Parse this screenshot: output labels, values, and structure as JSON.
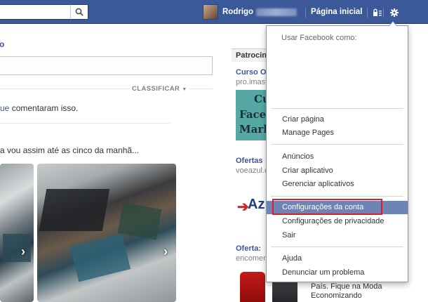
{
  "topbar": {
    "user_name": "Rodrigo",
    "home_label": "Página inicial"
  },
  "feed": {
    "heading_fragment": "o",
    "sort_label": "CLASSIFICAR",
    "comment_link_fragment": "ue",
    "comment_text": " comentaram isso.",
    "post_text": "a vou assim até as cinco da manhã..."
  },
  "sidebar": {
    "sponsored_header": "Patrocin",
    "ads": [
      {
        "title": "Curso O",
        "subtitle": "pro.imast",
        "image_lines": [
          "Cu",
          "Face",
          "Mark"
        ]
      },
      {
        "title": "Ofertas",
        "subtitle": "voeazul.c",
        "image_text": "Az"
      },
      {
        "title": "Oferta: ",
        "subtitle": "encomen",
        "description_lines": [
          "País. Fique na Moda",
          "Economizando"
        ]
      }
    ]
  },
  "account_menu": {
    "use_as_label": "Usar Facebook como:",
    "groups": [
      [
        "Criar página",
        "Manage Pages"
      ],
      [
        "Anúncios",
        "Criar aplicativo",
        "Gerenciar aplicativos"
      ],
      [
        "Configurações da conta",
        "Configurações de privacidade",
        "Sair"
      ],
      [
        "Ajuda",
        "Denunciar um problema"
      ]
    ],
    "active_item": "Configurações da conta"
  },
  "colors": {
    "topbar": "#3b5998",
    "link": "#3b5998",
    "menu_highlight": "#6d84b4",
    "annotation_box": "#d8202a"
  }
}
